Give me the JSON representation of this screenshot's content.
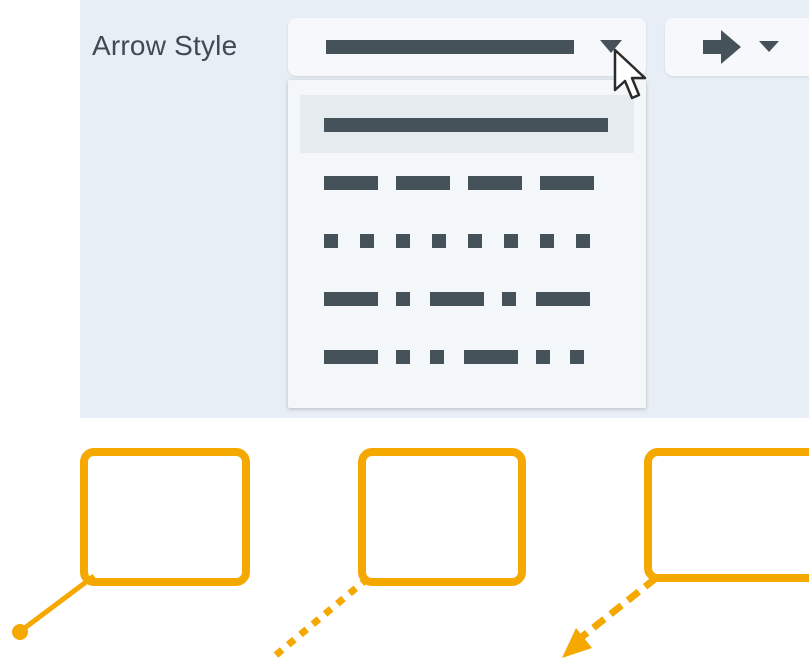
{
  "toolbar": {
    "arrow_style_label": "Arrow Style",
    "selected_style": "solid",
    "arrow_head_icon": "right-arrow-icon",
    "dropdown_caret_icon": "chevron-down-icon"
  },
  "menu": {
    "items": [
      {
        "style": "solid",
        "selected": true
      },
      {
        "style": "dash",
        "selected": false
      },
      {
        "style": "dot",
        "selected": false
      },
      {
        "style": "dash-dot",
        "selected": false
      },
      {
        "style": "dash-dot-dot",
        "selected": false
      }
    ]
  },
  "colors": {
    "panel": "#e8eef5",
    "line": "#45525a",
    "callout": "#f5a800"
  },
  "callouts": [
    {
      "line_style": "solid",
      "end": "dot"
    },
    {
      "line_style": "dot",
      "end": "none"
    },
    {
      "line_style": "dash",
      "end": "arrow"
    }
  ]
}
